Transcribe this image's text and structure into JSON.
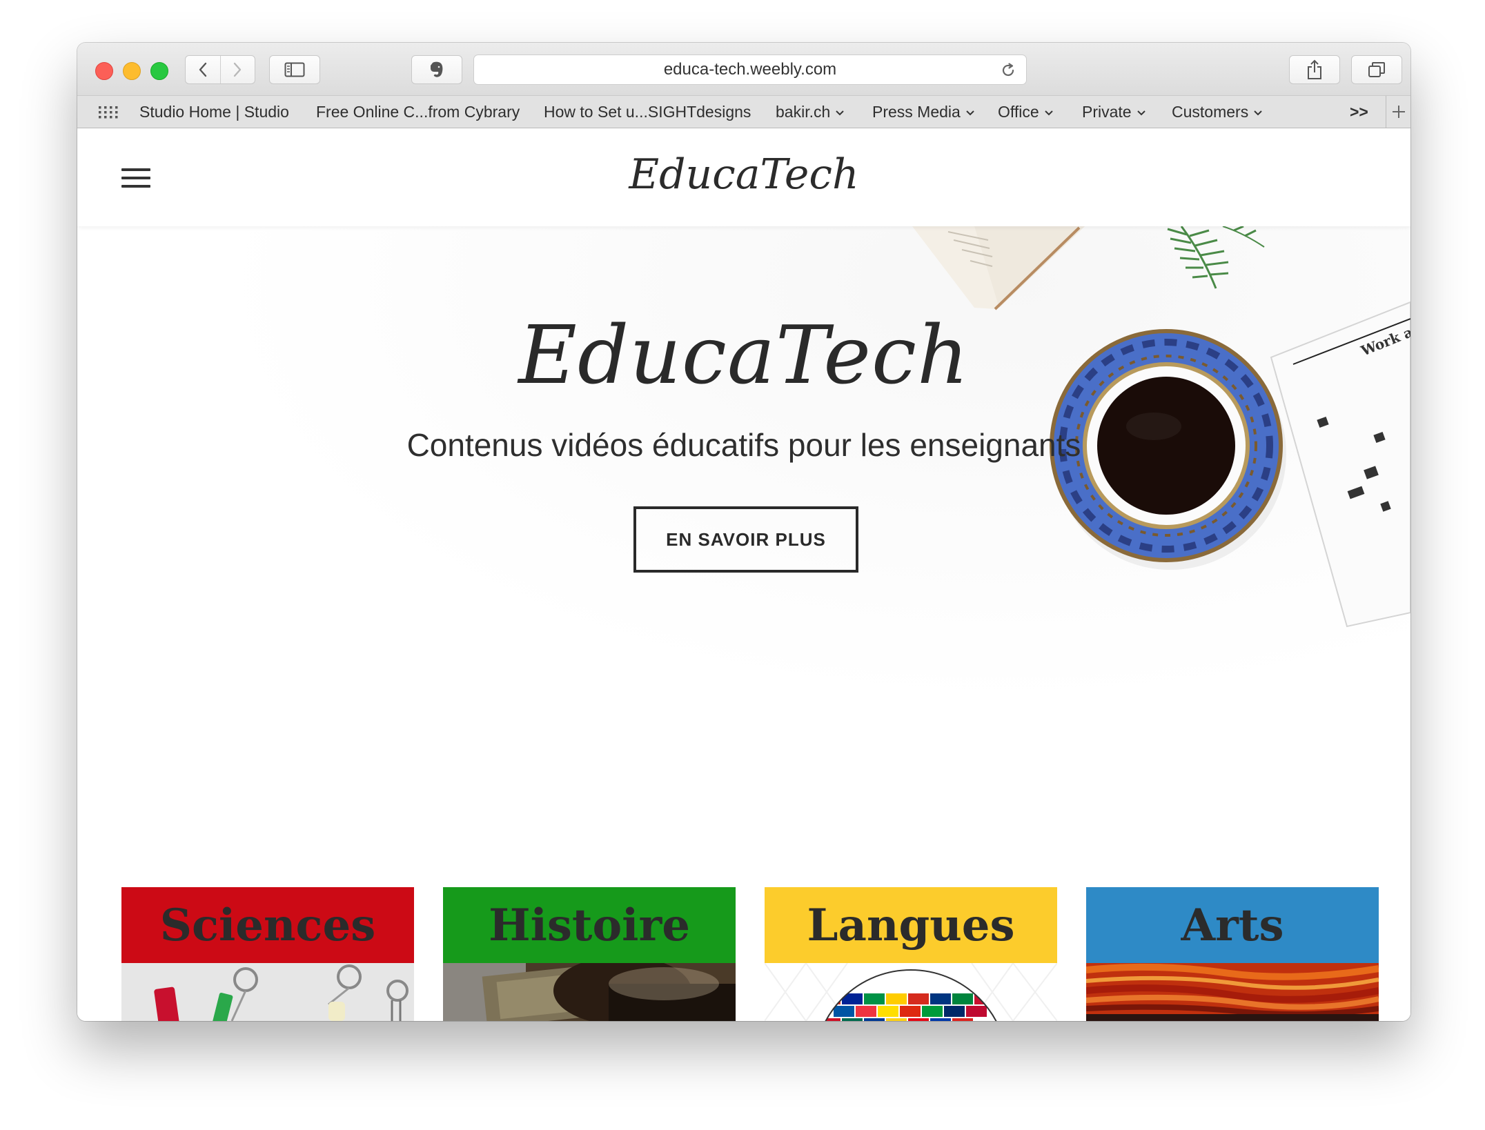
{
  "browser": {
    "url": "educa-tech.weebly.com",
    "bookmarks": [
      {
        "label": "Studio Home | Studio",
        "has_menu": false
      },
      {
        "label": "Free Online C...from Cybrary",
        "has_menu": false
      },
      {
        "label": "How to Set u...SIGHTdesigns",
        "has_menu": false
      },
      {
        "label": "bakir.ch",
        "has_menu": true
      },
      {
        "label": "Press Media",
        "has_menu": true
      },
      {
        "label": "Office",
        "has_menu": true
      },
      {
        "label": "Private",
        "has_menu": true
      },
      {
        "label": "Customers",
        "has_menu": true
      }
    ],
    "more_label": ">>"
  },
  "site": {
    "logo": "EducaTech"
  },
  "hero": {
    "title": "EducaTech",
    "subtitle": "Contenus vidéos éducatifs pour les enseignants",
    "cta": "EN SAVOIR PLUS",
    "decor_text": "Work a Doub"
  },
  "cards": [
    {
      "label": "Sciences",
      "color": "#cc0a15"
    },
    {
      "label": "Histoire",
      "color": "#169a1b"
    },
    {
      "label": "Langues",
      "color": "#fccc2c"
    },
    {
      "label": "Arts",
      "color": "#2e8ac6"
    }
  ]
}
